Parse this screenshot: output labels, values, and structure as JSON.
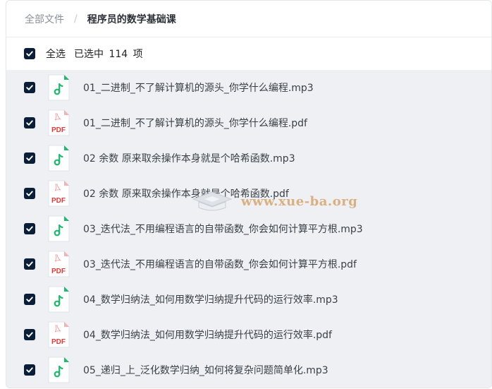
{
  "breadcrumb": {
    "root": "全部文件",
    "separator": "/",
    "current": "程序员的数学基础课"
  },
  "selection": {
    "select_all_label": "全选",
    "selected_summary": "已选中 114 项",
    "checked": true
  },
  "files": [
    {
      "name": "01_二进制_不了解计算机的源头_你学什么编程.mp3",
      "type": "mp3",
      "checked": true
    },
    {
      "name": "01_二进制_不了解计算机的源头_你学什么编程.pdf",
      "type": "pdf",
      "checked": true
    },
    {
      "name": "02 余数 原来取余操作本身就是个哈希函数.mp3",
      "type": "mp3",
      "checked": true
    },
    {
      "name": "02 余数 原来取余操作本身就是个哈希函数.pdf",
      "type": "pdf",
      "checked": true
    },
    {
      "name": "03_迭代法_不用编程语言的自带函数_你会如何计算平方根.mp3",
      "type": "mp3",
      "checked": true
    },
    {
      "name": "03_迭代法_不用编程语言的自带函数_你会如何计算平方根.pdf",
      "type": "pdf",
      "checked": true
    },
    {
      "name": "04_数学归纳法_如何用数学归纳提升代码的运行效率.mp3",
      "type": "mp3",
      "checked": true
    },
    {
      "name": "04_数学归纳法_如何用数学归纳提升代码的运行效率.pdf",
      "type": "pdf",
      "checked": true
    },
    {
      "name": "05_递归_上_泛化数学归纳_如何将复杂问题简单化.mp3",
      "type": "mp3",
      "checked": true
    }
  ],
  "icons": {
    "mp3": "music-note-icon",
    "pdf": "pdf-file-icon",
    "pdf_label": "PDF"
  },
  "colors": {
    "checkbox": "#0a1e37",
    "list_background": "#eef0f3",
    "music_green": "#1fb86e",
    "pdf_red": "#e03a3a"
  },
  "watermark": {
    "text": "www.xue-ba.org"
  }
}
